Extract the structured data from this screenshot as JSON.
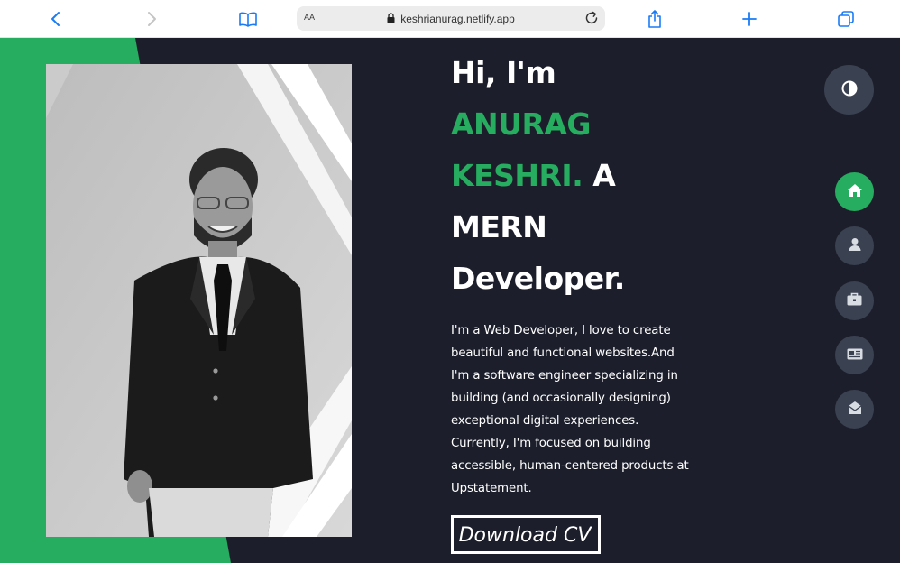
{
  "browser": {
    "text_size_label": "AA",
    "url": "keshrianurag.netlify.app",
    "icons": [
      "back-icon",
      "forward-icon",
      "bookmarks-icon",
      "text-size-icon",
      "lock-icon",
      "reload-icon",
      "share-icon",
      "new-tab-icon",
      "tabs-icon"
    ]
  },
  "hero": {
    "greeting": "Hi, I'm",
    "name_first": "ANURAG",
    "name_last": "KESHRI.",
    "role_prefix": "A",
    "role_mid": "MERN",
    "role_end": "Developer.",
    "bio": "I'm a Web Developer, I love to create beautiful and functional websites.And I'm a software engineer specializing in building (and occasionally designing) exceptional digital experiences. Currently, I'm focused on building accessible, human-centered products at Upstatement.",
    "cv_button": "Download CV"
  },
  "side_nav": {
    "items": [
      "home-icon",
      "user-icon",
      "briefcase-icon",
      "news-icon",
      "envelope-open-icon"
    ],
    "active": "home-icon",
    "theme_toggle": "contrast-icon"
  },
  "colors": {
    "background": "#1c1f2b",
    "accent": "#26ad5f",
    "button_dark": "#3a4150",
    "text": "#ffffff",
    "browser_blue": "#1a7cf5"
  }
}
